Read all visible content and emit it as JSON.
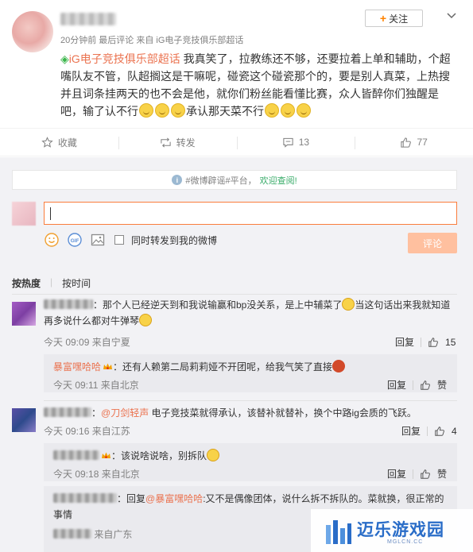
{
  "post": {
    "meta": "20分钟前 最后评论 来自 iG电子竞技俱乐部超话",
    "follow_label": "关注",
    "super_topic": "iG电子竞技俱乐部超话",
    "text_part1": "我真笑了，拉教练还不够，还要拉着上单和辅助，个超嘴队友不管，队超搁这是干嘛呢，碰瓷这个碰瓷那个的，要是别人真菜，上热搜并且词条挂两天的也不会是他，就你们粉丝能看懂比赛，众人皆醉你们独醒是吧，输了认不行",
    "text_part2": "承认那天菜不行"
  },
  "actions": {
    "favorite": "收藏",
    "repost": "转发",
    "comment_count": "13",
    "like_count": "77"
  },
  "comments_panel": {
    "notice_prefix": "#微博辟谣#平台，",
    "notice_link": "欢迎查阅!",
    "sync_repost_label": "同时转发到我的微博",
    "submit_label": "评论",
    "sort_hot": "按热度",
    "sort_time": "按时间"
  },
  "comments": [
    {
      "text": "：那个人已经逆天到和我说输赢和bp没关系，是上中辅菜了",
      "text2": "当这句话出来我就知道再多说什么都对牛弹琴",
      "time": "今天 09:09 来自宁夏",
      "reply_label": "回复",
      "likes": "15",
      "replies": [
        {
          "user": "暴富嘿哈哈",
          "text": "：还有人赖第二局莉莉娅不开团呢，给我气笑了直接",
          "time": "今天 09:11 来自北京",
          "reply_label": "回复",
          "like_label": "赞"
        }
      ]
    },
    {
      "mention": "@刀剑轻声",
      "text": " 电子竞技菜就得承认，该替补就替补，换个中路ig会质的飞跃。",
      "time": "今天 09:16 来自江苏",
      "reply_label": "回复",
      "likes": "4",
      "replies": [
        {
          "text": "：该说啥说啥，别拆队",
          "time": "今天 09:18 来自北京",
          "reply_label": "回复",
          "like_label": "赞"
        },
        {
          "reply_prefix": "：回复",
          "mention": "@暴富嘿哈哈",
          "text": ":又不是偶像团体，说什么拆不拆队的。菜就换，很正常的事情",
          "time": "来自广东"
        }
      ]
    }
  ],
  "watermark": {
    "name": "迈乐游戏园",
    "domain": "MGLCN.CC"
  },
  "colors": {
    "accent_orange": "#eb7350",
    "follow_plus": "#ff8200",
    "input_border": "#fa7d3c",
    "submit_bg": "#ffc09f",
    "panel_bg": "#f2f2f5",
    "topic_green": "#3ab54a",
    "watermark_blue": "#2a6dc8"
  }
}
